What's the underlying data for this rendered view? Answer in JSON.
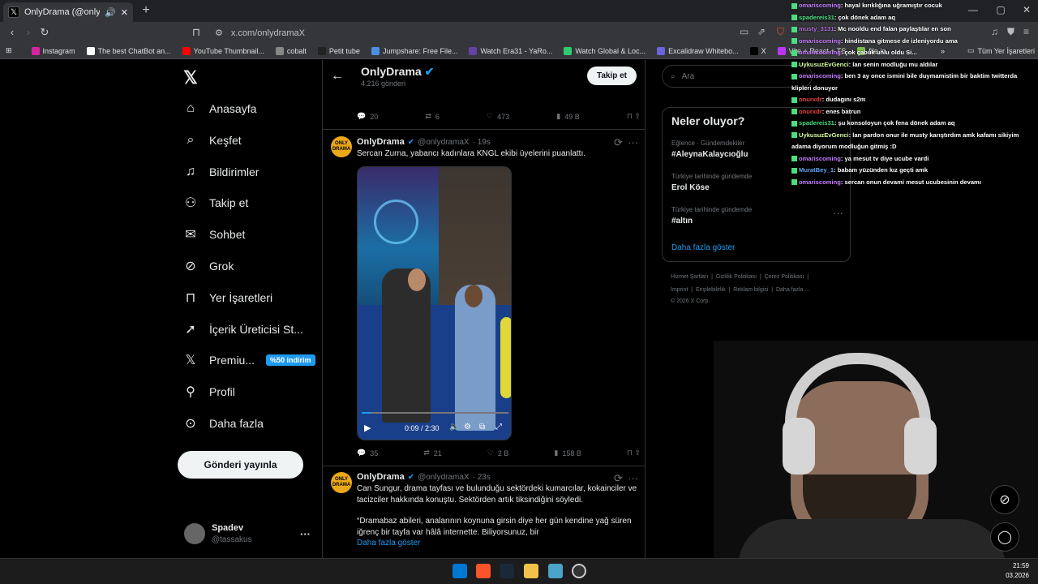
{
  "browser": {
    "tab_title": "OnlyDrama (@onlydramaX) /",
    "url": "x.com/onlydramaX",
    "bookmarks": [
      {
        "label": "Instagram",
        "color": "#d6249f"
      },
      {
        "label": "The best ChatBot an...",
        "color": "#ffffff"
      },
      {
        "label": "YouTube Thumbnail...",
        "color": "#ff0000"
      },
      {
        "label": "cobalt",
        "color": "#888888"
      },
      {
        "label": "Petit tube",
        "color": "#222222"
      },
      {
        "label": "Jumpshare: Free File...",
        "color": "#4a90e2"
      },
      {
        "label": "Watch Era31 - YaRo...",
        "color": "#6441a5"
      },
      {
        "label": "Watch Global & Loc...",
        "color": "#2ecc71"
      },
      {
        "label": "Excalidraw Whitebo...",
        "color": "#6965db"
      },
      {
        "label": "X",
        "color": "#000000"
      },
      {
        "label": "Vite + React + TS",
        "color": "#bd34fe"
      },
      {
        "label": "file.io",
        "color": "#7ac143"
      }
    ],
    "all_bookmarks": "Tüm Yer İşaretleri"
  },
  "sidebar": {
    "items": [
      {
        "label": "Anasayfa",
        "icon": "home-icon"
      },
      {
        "label": "Keşfet",
        "icon": "search-icon"
      },
      {
        "label": "Bildirimler",
        "icon": "bell-icon"
      },
      {
        "label": "Takip et",
        "icon": "follow-icon"
      },
      {
        "label": "Sohbet",
        "icon": "mail-icon"
      },
      {
        "label": "Grok",
        "icon": "grok-icon"
      },
      {
        "label": "Yer İşaretleri",
        "icon": "bookmark-icon"
      },
      {
        "label": "İçerik Üreticisi St...",
        "icon": "rocket-icon"
      },
      {
        "label": "Premiu...",
        "icon": "x-logo-icon"
      },
      {
        "label": "Profil",
        "icon": "person-icon"
      },
      {
        "label": "Daha fazla",
        "icon": "more-circle-icon"
      }
    ],
    "premium_badge": "%50 indirim",
    "post_button": "Gönderi yayınla",
    "account": {
      "name": "Spadev",
      "handle": "@tassakus"
    }
  },
  "profile_header": {
    "name": "OnlyDrama",
    "posts_count": "4.216 gönderi",
    "follow_button": "Takip et"
  },
  "top_stats": {
    "replies": "20",
    "reposts": "6",
    "likes": "473",
    "views": "49 B"
  },
  "posts": [
    {
      "name": "OnlyDrama",
      "handle": "@onlydramaX",
      "time": "· 19s",
      "text": "Sercan Zurna, yabancı kadınlara KNGL ekibi üyelerini puanlattı.",
      "video_time": "0:09 / 2:30",
      "stats": {
        "replies": "35",
        "reposts": "21",
        "likes": "2 B",
        "views": "158 B"
      }
    },
    {
      "name": "OnlyDrama",
      "handle": "@onlydramaX",
      "time": "· 23s",
      "text": "Can Sungur, drama tayfası ve bulunduğu sektördeki kumarcılar, kokainciler ve tacizciler hakkında konuştu. Sektörden artık tiksindiğini söyledi.",
      "quote": "“Dramabaz abileri, analarının koynuna girsin diye her gün kendine yağ süren iğrenç bir tayfa var hâlâ internette. Biliyorsunuz, bir",
      "show_more": "Daha fazla göster"
    }
  ],
  "right": {
    "search_placeholder": "Ara",
    "trends_title": "Neler oluyor?",
    "trends": [
      {
        "category": "Eğlence · Gündemdekiler",
        "name": "#AleynaKalaycıoğlu"
      },
      {
        "category": "Türkiye tarihinde gündemde",
        "name": "Erol Köse"
      },
      {
        "category": "Türkiye tarihinde gündemde",
        "name": "#altın"
      }
    ],
    "show_more": "Daha fazla göster",
    "footer": [
      "Hizmet Şartları",
      "Gizlilik Politikası",
      "Çerez Politikası",
      "Imprint",
      "Erişilebilirlik",
      "Reklam bilgisi",
      "Daha fazla ...",
      "© 2026 X Corp."
    ]
  },
  "chat": [
    {
      "user": "omariscoming",
      "color": "#c77dff",
      "msg": ": hayal kırıklığına uğramıştır cocuk"
    },
    {
      "user": "spadereis31",
      "color": "#4ade80",
      "msg": ": çok dönek adam aq"
    },
    {
      "user": "musty_3131",
      "color": "#b06ad6",
      "msg": ": Mc nooldu end falan paylaştılar en son"
    },
    {
      "user": "omariscoming",
      "color": "#c77dff",
      "msg": ": hindistana gitmese de izleniyordu ama"
    },
    {
      "user": "omariscoming",
      "color": "#c77dff",
      "msg": ": çok çabuk unlu oldu Si..."
    },
    {
      "user": "UykusuzEvGenci",
      "color": "#d9f99d",
      "msg": ": lan senin modluğu mu aldılar"
    },
    {
      "user": "omariscoming",
      "color": "#c77dff",
      "msg": ": ben 3 ay once ismini bile duymamistim bir baktim twitterda klipleri donuyor"
    },
    {
      "user": "onurxdr",
      "color": "#ef4444",
      "msg": ": dudagını s2m"
    },
    {
      "user": "onurxdr",
      "color": "#ef4444",
      "msg": ": enes batrun"
    },
    {
      "user": "spadereis31",
      "color": "#4ade80",
      "msg": ": şu konsoloyun çok fena dönek adam aq"
    },
    {
      "user": "UykusuzEvGenci",
      "color": "#d9f99d",
      "msg": ": lan pardon onur ile musty karıştırdım amk kafamı sikiyim adama diyorum modluğun gitmiş :D"
    },
    {
      "user": "omariscoming",
      "color": "#c77dff",
      "msg": ": ya mesut tv diye ucube vardi"
    },
    {
      "user": "MuratBey_1",
      "color": "#60a5fa",
      "msg": ": babam yüzünden kız geçti amk"
    },
    {
      "user": "omariscoming",
      "color": "#c77dff",
      "msg": ": sercan onun devami mesut ucubesinin devamı"
    }
  ],
  "clock": {
    "time": "21:59",
    "date": "03.2026"
  }
}
